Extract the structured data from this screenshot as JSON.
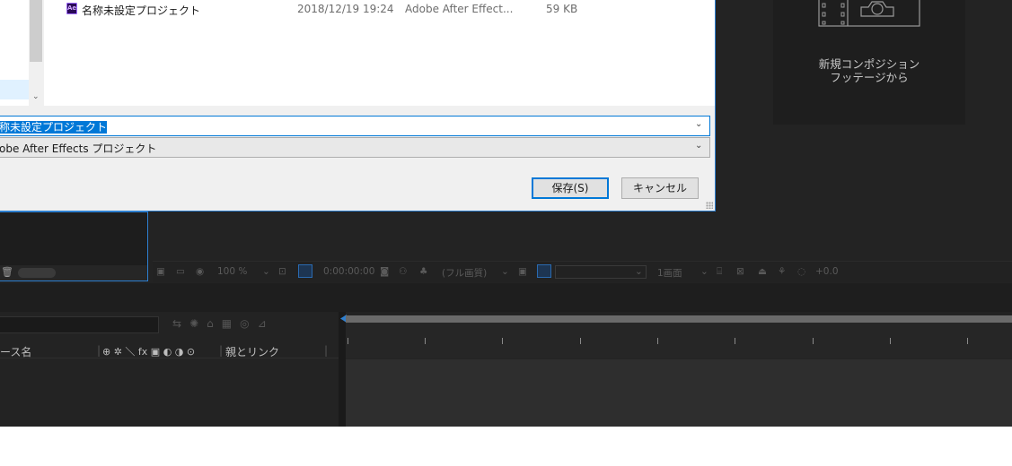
{
  "dialog": {
    "file": {
      "name": "名称未設定プロジェクト",
      "date": "2018/12/19 19:24",
      "type": "Adobe After Effect...",
      "size": "59 KB",
      "icon_label": "Ae"
    },
    "filename_value": "称未設定プロジェクト",
    "filetype_value": "obe After Effects プロジェクト",
    "save_button": "保存(S)",
    "cancel_button": "キャンセル"
  },
  "welcome": {
    "line1": "新規コンポジション",
    "line2": "フッテージから"
  },
  "comp_toolbar": {
    "zoom": "100 %",
    "timecode": "0:00:00:00",
    "resolution": "(フル画質)",
    "view": "1画面",
    "exposure": "+0.0"
  },
  "timeline": {
    "source_name_header": "ース名",
    "switches_header": "⊕ ✲ ＼ fx ▣ ◐ ◑ ⊙",
    "parent_header": "親とリンク"
  },
  "colors": {
    "accent": "#0078d7",
    "ae_background": "#232323",
    "panel_focus": "#2d7fd0"
  }
}
